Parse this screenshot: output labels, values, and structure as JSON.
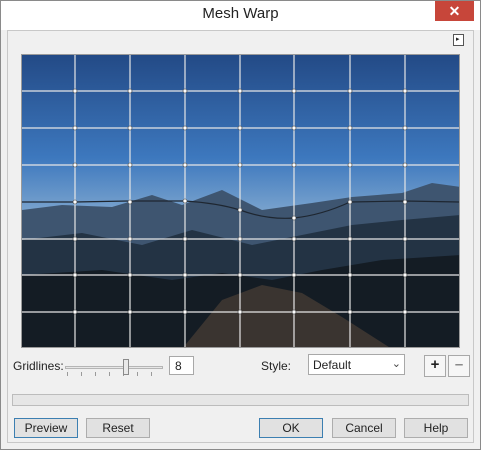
{
  "window": {
    "title": "Mesh Warp",
    "close_glyph": "✕"
  },
  "expand_glyph": "▸",
  "gridlines": {
    "label": "Gridlines:",
    "value": "8",
    "slider_level": 0.63
  },
  "style": {
    "label": "Style:",
    "selected": "Default"
  },
  "zoom": {
    "plus": "+",
    "minus": "–"
  },
  "buttons": {
    "preview": "Preview",
    "reset": "Reset",
    "ok": "OK",
    "cancel": "Cancel",
    "help": "Help"
  },
  "icons": [
    "close-icon",
    "expand-arrow-icon",
    "chevron-down-icon"
  ]
}
